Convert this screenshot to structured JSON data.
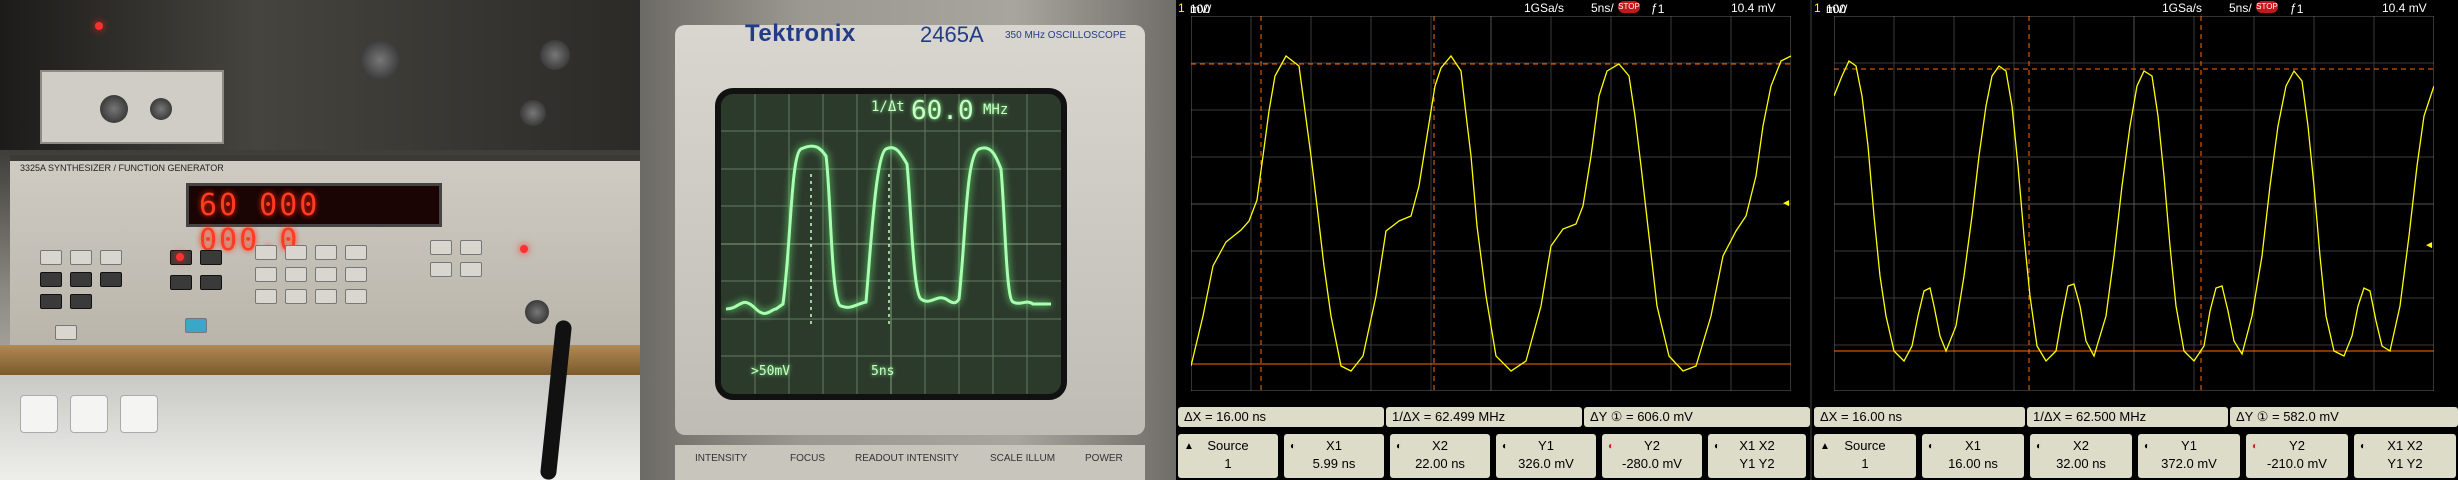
{
  "generator": {
    "label": "3325A SYNTHESIZER / FUNCTION GENERATOR",
    "display": "60 000 000.0"
  },
  "analog_scope": {
    "brand": "Tektronix",
    "model": "2465A",
    "model_sub": "350 MHz OSCILLOSCOPE",
    "readout_freq_symbol": "1/Δt",
    "readout_freq": "60.0",
    "readout_freq_unit": "MHz",
    "readout_volts": "50mV",
    "readout_time": "5ns",
    "controls": [
      "INTENSITY",
      "FOCUS",
      "READOUT INTENSITY",
      "SCALE ILLUM",
      "POWER"
    ]
  },
  "screenshots": [
    {
      "top": {
        "ch": "1",
        "vdiv": "100",
        "vunit": "mV/",
        "rate": "1GSa/s",
        "tdiv": "5ns/",
        "stop": "STOP",
        "trig": "1",
        "trig_level": "10.4 mV"
      },
      "measure": {
        "dx": "ΔX = 16.00 ns",
        "inv_dx": "1/ΔX = 62.499 MHz",
        "dy": "ΔY ① = 606.0 mV"
      },
      "softkeys": [
        {
          "l1": "Source",
          "l2": "1"
        },
        {
          "l1": "X1",
          "l2": "5.99 ns"
        },
        {
          "l1": "X2",
          "l2": "22.00 ns"
        },
        {
          "l1": "Y1",
          "l2": "326.0 mV"
        },
        {
          "l1": "Y2",
          "l2": "-280.0 mV"
        },
        {
          "l1": "X1  X2",
          "l2": "Y1  Y2"
        }
      ]
    },
    {
      "top": {
        "ch": "1",
        "vdiv": "100",
        "vunit": "mV/",
        "rate": "1GSa/s",
        "tdiv": "5ns/",
        "stop": "STOP",
        "trig": "1",
        "trig_level": "10.4 mV"
      },
      "measure": {
        "dx": "ΔX = 16.00 ns",
        "inv_dx": "1/ΔX = 62.500 MHz",
        "dy": "ΔY ① = 582.0 mV"
      },
      "softkeys": [
        {
          "l1": "Source",
          "l2": "1"
        },
        {
          "l1": "X1",
          "l2": "16.00 ns"
        },
        {
          "l1": "X2",
          "l2": "32.00 ns"
        },
        {
          "l1": "Y1",
          "l2": "372.0 mV"
        },
        {
          "l1": "Y2",
          "l2": "-210.0 mV"
        },
        {
          "l1": "X1  X2",
          "l2": "Y1  Y2"
        }
      ]
    }
  ],
  "colors": {
    "trace": "#ffff00",
    "crt_trace": "#a8ffb0",
    "gen_led": "#ff3c20",
    "cursor": "#ff6a00",
    "brand": "#223c8a"
  }
}
